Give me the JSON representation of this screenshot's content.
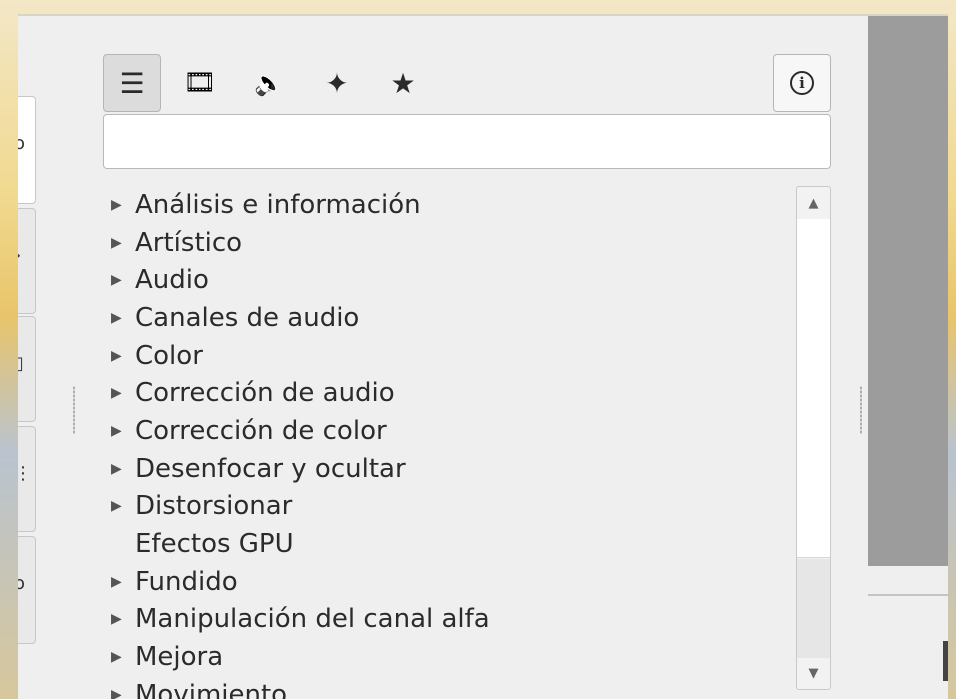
{
  "toolbar": {
    "buttons": [
      {
        "name": "list-view",
        "icon": "list-icon",
        "glyph": "☰",
        "active": true
      },
      {
        "name": "video-effects",
        "icon": "film-icon",
        "glyph": "🎞",
        "active": false
      },
      {
        "name": "audio-effects",
        "icon": "speaker-icon",
        "glyph": "🔈",
        "active": false
      },
      {
        "name": "custom-effects",
        "icon": "star-custom-icon",
        "glyph": "✦",
        "active": false
      },
      {
        "name": "favorites",
        "icon": "star-icon",
        "glyph": "★",
        "active": false
      }
    ],
    "info_glyph": "i"
  },
  "search": {
    "value": "",
    "placeholder": ""
  },
  "effects_list": [
    {
      "label": "Análisis e información",
      "expandable": true
    },
    {
      "label": "Artístico",
      "expandable": true
    },
    {
      "label": "Audio",
      "expandable": true
    },
    {
      "label": "Canales de audio",
      "expandable": true
    },
    {
      "label": "Color",
      "expandable": true
    },
    {
      "label": "Corrección de audio",
      "expandable": true
    },
    {
      "label": "Corrección de color",
      "expandable": true
    },
    {
      "label": "Desenfocar y ocultar",
      "expandable": true
    },
    {
      "label": "Distorsionar",
      "expandable": true
    },
    {
      "label": "Efectos GPU",
      "expandable": false
    },
    {
      "label": "Fundido",
      "expandable": true
    },
    {
      "label": "Manipulación del canal alfa",
      "expandable": true
    },
    {
      "label": "Mejora",
      "expandable": true
    },
    {
      "label": "Movimiento",
      "expandable": true
    }
  ],
  "expand_glyph": "▶",
  "scrollbar": {
    "up_glyph": "▲",
    "down_glyph": "▼"
  }
}
